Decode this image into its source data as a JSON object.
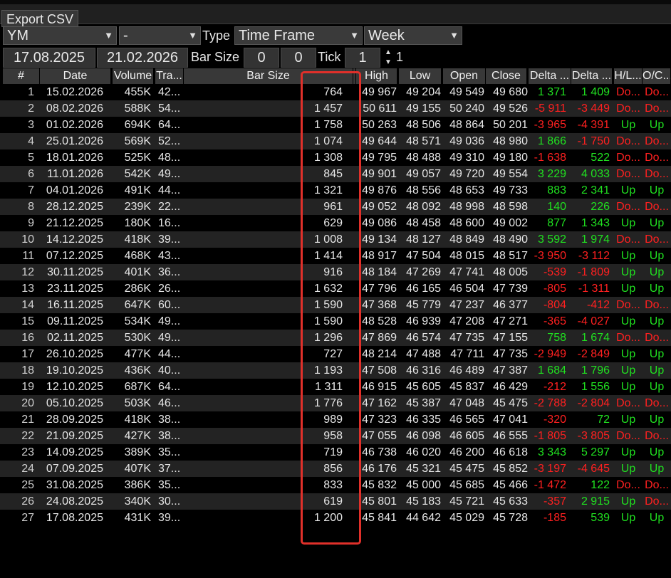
{
  "toolbar": {
    "export_label": "Export CSV"
  },
  "filters": {
    "symbol": "YM",
    "symbol_sub": "-",
    "type_label": "Type",
    "type_value": "Time Frame",
    "period_value": "Week",
    "date_from": "17.08.2025",
    "date_to": "21.02.2026",
    "bar_size_label": "Bar Size",
    "bar_size_a": "0",
    "bar_size_b": "0",
    "tick_label": "Tick",
    "tick_value": "1",
    "tick_extra": "1"
  },
  "table": {
    "headers": [
      "#",
      "Date",
      "Volume",
      "Tra...",
      "Bar Size",
      "",
      "High",
      "Low",
      "Open",
      "Close",
      "Delta ...",
      "Delta ...",
      "H/L...",
      "O/C..."
    ],
    "rows": [
      [
        "1",
        "15.02.2026",
        "455K",
        "42...",
        "764",
        "49 967",
        "49 204",
        "49 549",
        "49 680",
        "1 371",
        "1 409",
        "Do...",
        "Do..."
      ],
      [
        "2",
        "08.02.2026",
        "588K",
        "54...",
        "1 457",
        "50 611",
        "49 155",
        "50 240",
        "49 526",
        "-5 911",
        "-3 449",
        "Do...",
        "Do..."
      ],
      [
        "3",
        "01.02.2026",
        "694K",
        "64...",
        "1 758",
        "50 263",
        "48 506",
        "48 864",
        "50 201",
        "-3 965",
        "-4 391",
        "Up",
        "Up"
      ],
      [
        "4",
        "25.01.2026",
        "569K",
        "52...",
        "1 074",
        "49 644",
        "48 571",
        "49 036",
        "48 980",
        "1 866",
        "-1 750",
        "Do...",
        "Do..."
      ],
      [
        "5",
        "18.01.2026",
        "525K",
        "48...",
        "1 308",
        "49 795",
        "48 488",
        "49 310",
        "49 180",
        "-1 638",
        "522",
        "Do...",
        "Do..."
      ],
      [
        "6",
        "11.01.2026",
        "542K",
        "49...",
        "845",
        "49 901",
        "49 057",
        "49 720",
        "49 554",
        "3 229",
        "4 033",
        "Do...",
        "Do..."
      ],
      [
        "7",
        "04.01.2026",
        "491K",
        "44...",
        "1 321",
        "49 876",
        "48 556",
        "48 653",
        "49 733",
        "883",
        "2 341",
        "Up",
        "Up"
      ],
      [
        "8",
        "28.12.2025",
        "239K",
        "22...",
        "961",
        "49 052",
        "48 092",
        "48 998",
        "48 598",
        "140",
        "226",
        "Do...",
        "Do..."
      ],
      [
        "9",
        "21.12.2025",
        "180K",
        "16...",
        "629",
        "49 086",
        "48 458",
        "48 600",
        "49 002",
        "877",
        "1 343",
        "Up",
        "Up"
      ],
      [
        "10",
        "14.12.2025",
        "418K",
        "39...",
        "1 008",
        "49 134",
        "48 127",
        "48 849",
        "48 490",
        "3 592",
        "1 974",
        "Do...",
        "Do..."
      ],
      [
        "11",
        "07.12.2025",
        "468K",
        "43...",
        "1 414",
        "48 917",
        "47 504",
        "48 015",
        "48 517",
        "-3 950",
        "-3 112",
        "Up",
        "Up"
      ],
      [
        "12",
        "30.11.2025",
        "401K",
        "36...",
        "916",
        "48 184",
        "47 269",
        "47 741",
        "48 005",
        "-539",
        "-1 809",
        "Up",
        "Up"
      ],
      [
        "13",
        "23.11.2025",
        "286K",
        "26...",
        "1 632",
        "47 796",
        "46 165",
        "46 504",
        "47 739",
        "-805",
        "-1 311",
        "Up",
        "Up"
      ],
      [
        "14",
        "16.11.2025",
        "647K",
        "60...",
        "1 590",
        "47 368",
        "45 779",
        "47 237",
        "46 377",
        "-804",
        "-412",
        "Do...",
        "Do..."
      ],
      [
        "15",
        "09.11.2025",
        "534K",
        "49...",
        "1 590",
        "48 528",
        "46 939",
        "47 208",
        "47 271",
        "-365",
        "-4 027",
        "Up",
        "Up"
      ],
      [
        "16",
        "02.11.2025",
        "530K",
        "49...",
        "1 296",
        "47 869",
        "46 574",
        "47 735",
        "47 155",
        "758",
        "1 674",
        "Do...",
        "Do..."
      ],
      [
        "17",
        "26.10.2025",
        "477K",
        "44...",
        "727",
        "48 214",
        "47 488",
        "47 711",
        "47 735",
        "-2 949",
        "-2 849",
        "Up",
        "Up"
      ],
      [
        "18",
        "19.10.2025",
        "436K",
        "40...",
        "1 193",
        "47 508",
        "46 316",
        "46 489",
        "47 387",
        "1 684",
        "1 796",
        "Up",
        "Up"
      ],
      [
        "19",
        "12.10.2025",
        "687K",
        "64...",
        "1 311",
        "46 915",
        "45 605",
        "45 837",
        "46 429",
        "-212",
        "1 556",
        "Up",
        "Up"
      ],
      [
        "20",
        "05.10.2025",
        "503K",
        "46...",
        "1 776",
        "47 162",
        "45 387",
        "47 048",
        "45 475",
        "-2 788",
        "-2 804",
        "Do...",
        "Do..."
      ],
      [
        "21",
        "28.09.2025",
        "418K",
        "38...",
        "989",
        "47 323",
        "46 335",
        "46 565",
        "47 041",
        "-320",
        "72",
        "Up",
        "Up"
      ],
      [
        "22",
        "21.09.2025",
        "427K",
        "38...",
        "958",
        "47 055",
        "46 098",
        "46 605",
        "46 555",
        "-1 805",
        "-3 805",
        "Do...",
        "Do..."
      ],
      [
        "23",
        "14.09.2025",
        "389K",
        "35...",
        "719",
        "46 738",
        "46 020",
        "46 200",
        "46 618",
        "3 343",
        "5 297",
        "Up",
        "Up"
      ],
      [
        "24",
        "07.09.2025",
        "407K",
        "37...",
        "856",
        "46 176",
        "45 321",
        "45 475",
        "45 852",
        "-3 197",
        "-4 645",
        "Up",
        "Up"
      ],
      [
        "25",
        "31.08.2025",
        "386K",
        "35...",
        "833",
        "45 832",
        "45 000",
        "45 685",
        "45 466",
        "-1 472",
        "122",
        "Do...",
        "Do..."
      ],
      [
        "26",
        "24.08.2025",
        "340K",
        "30...",
        "619",
        "45 801",
        "45 183",
        "45 721",
        "45 633",
        "-357",
        "2 915",
        "Up",
        "Do..."
      ],
      [
        "27",
        "17.08.2025",
        "431K",
        "39...",
        "1 200",
        "45 841",
        "44 642",
        "45 029",
        "45 728",
        "-185",
        "539",
        "Up",
        "Up"
      ]
    ]
  },
  "colors": {
    "up": "#20e020",
    "down": "#ff2020",
    "highlight": "#e0302a"
  },
  "icons": {
    "dropdown": "chevron-down-icon",
    "spinner": "spinner-icon"
  }
}
